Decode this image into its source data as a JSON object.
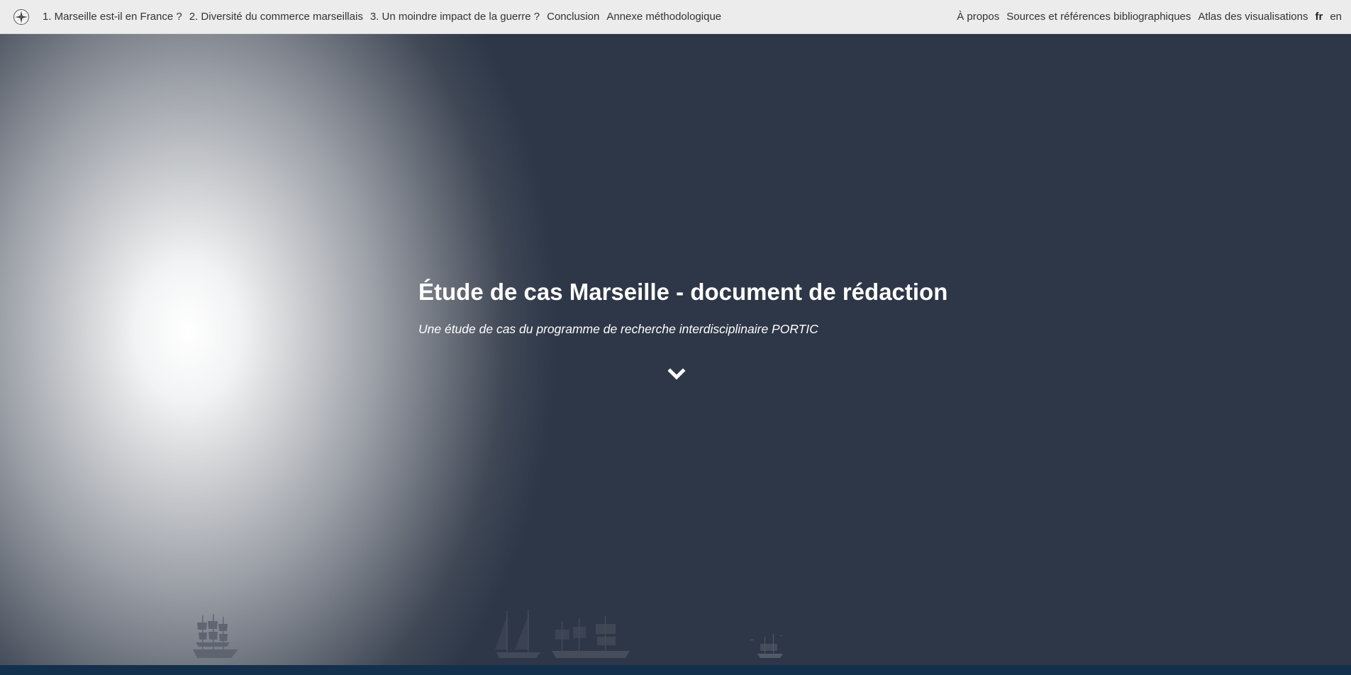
{
  "nav": {
    "logo_icon": "compass-rose-icon",
    "left_links": [
      {
        "label": "1. Marseille est-il en France ?"
      },
      {
        "label": "2. Diversité du commerce marseillais"
      },
      {
        "label": "3. Un moindre impact de la guerre ?"
      },
      {
        "label": "Conclusion"
      },
      {
        "label": "Annexe méthodologique"
      }
    ],
    "right_links": [
      {
        "label": "À propos"
      },
      {
        "label": "Sources et références bibliographiques"
      },
      {
        "label": "Atlas des visualisations"
      }
    ],
    "languages": [
      {
        "label": "fr",
        "active": true
      },
      {
        "label": "en",
        "active": false
      }
    ]
  },
  "hero": {
    "title": "Étude de cas Marseille - document de rédaction",
    "subtitle": "Une étude de cas du programme de recherche interdisciplinaire PORTIC",
    "scroll_icon": "chevron-down-icon",
    "background_color": "#2d3748",
    "text_color": "#ffffff"
  },
  "footer": {
    "band_color": "#13304d"
  }
}
